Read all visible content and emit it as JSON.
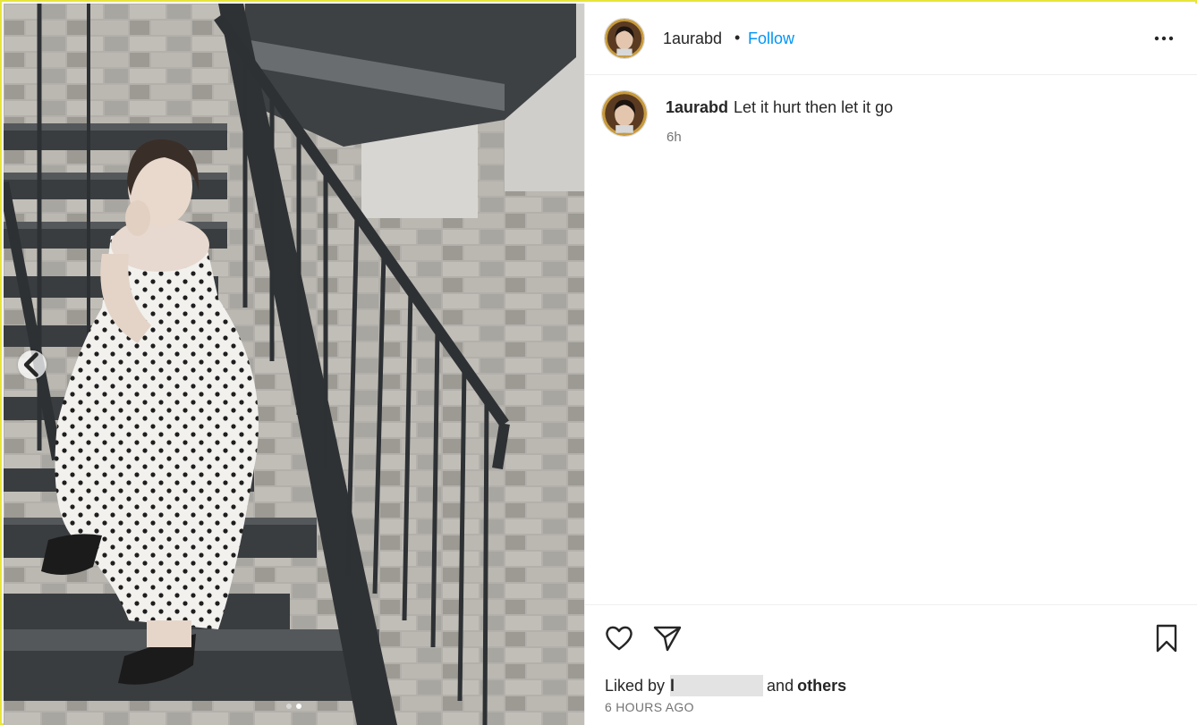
{
  "post": {
    "username": "1aurabd",
    "separator": "•",
    "follow_label": "Follow",
    "more_icon": "more-options-icon",
    "caption_username": "1aurabd",
    "caption_text": "Let it hurt then let it go",
    "caption_age": "6h",
    "liked_by_prefix": "Liked by",
    "liked_by_user": "l",
    "liked_by_and": "and",
    "liked_by_others": "others",
    "timestamp": "6 HOURS AGO"
  },
  "media": {
    "carousel_current_index": 2,
    "carousel_count": 2
  },
  "icons": [
    "heart-icon",
    "share-icon",
    "bookmark-icon",
    "chevron-left-icon"
  ],
  "colors": {
    "follow": "#0095f6",
    "frame": "#e8e53a",
    "muted": "#737373"
  }
}
